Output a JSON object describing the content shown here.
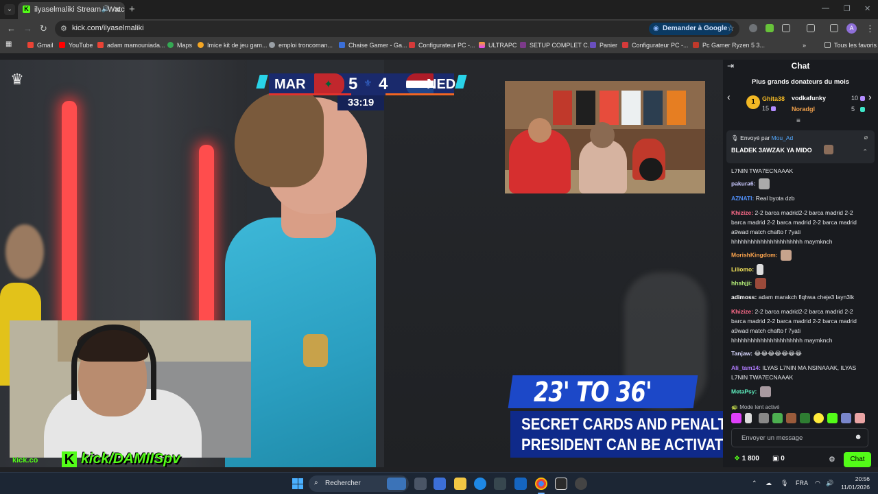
{
  "browser": {
    "tab_title": "ilyaselmaliki Stream - Watc",
    "url": "kick.com/ilyaselmaliki",
    "ask_google": "Demander à Google",
    "bookmarks": [
      "Gmail",
      "YouTube",
      "adam mamouniada...",
      "Maps",
      "Imice kit de jeu gam...",
      "emploi troncoman...",
      "Chaise Gamer - Ga...",
      "Configurateur PC -...",
      "ULTRAPC",
      "SETUP COMPLET C...",
      "Panier",
      "Configurateur PC -...",
      "Pc Gamer Ryzen 5 3..."
    ],
    "all_bookmarks": "Tous les favoris",
    "profile_initial": "A"
  },
  "scoreboard": {
    "home": "MAR",
    "away": "NED",
    "home_score": "5",
    "away_score": "4",
    "clock": "33:19"
  },
  "overlay": {
    "kick_handle": "kick/DAMIISpv",
    "promo_top": "23' TO 36'",
    "promo_line1": "SECRET CARDS AND PENALTY",
    "promo_line2": "PRESIDENT CAN BE ACTIVATED"
  },
  "chat": {
    "title": "Chat",
    "donors_title": "Plus grands donateurs du mois",
    "donors": [
      {
        "rank": "1",
        "name": "Ghita38",
        "amount": "15",
        "color": "#f2b824"
      },
      {
        "name": "vodkafunky",
        "amount": "10",
        "color": "#ffffff"
      },
      {
        "name": "Noradgl",
        "amount": "5",
        "color": "#f0a04b"
      }
    ],
    "pinned": {
      "sent_by_label": "Envoyé par",
      "sent_by_user": "Mou_Ad",
      "message": "BLADEK 3AWZAK YA MIDO"
    },
    "messages": [
      {
        "user": "",
        "color": "#ffffff",
        "text": "L7NIN TWA7ECNAAAK"
      },
      {
        "user": "pakura6:",
        "color": "#c9c9ff",
        "text": ""
      },
      {
        "user": "AZNATI:",
        "color": "#4f8ef7",
        "text": "Real byota dzb"
      },
      {
        "user": "Khizize:",
        "color": "#ff6b8a",
        "text": "2-2 barca madrid2-2 barca madrid 2-2 barca madrid 2-2 barca madrid 2-2 barca madrid a9wad match chafto f 7yati hhhhhhhhhhhhhhhhhhhhhh maymknch"
      },
      {
        "user": "MorishKingdom:",
        "color": "#ffa64d",
        "text": ""
      },
      {
        "user": "Liliomo:",
        "color": "#f2e35a",
        "text": ""
      },
      {
        "user": "hhshjji:",
        "color": "#b7f27a",
        "text": ""
      },
      {
        "user": "adimoss:",
        "color": "#ffffff",
        "text": "adam marakch flqhwa cheje3 layn3lk"
      },
      {
        "user": "Khizize:",
        "color": "#ff6b8a",
        "text": "2-2 barca madrid2-2 barca madrid 2-2 barca madrid 2-2 barca madrid 2-2 barca madrid a9wad match chafto f 7yati hhhhhhhhhhhhhhhhhhhhhh maymknch"
      },
      {
        "user": "Tanjaw:",
        "color": "#d8d8ff",
        "text": "😂😂😂😂😂😂😂"
      },
      {
        "user": "Ali_tam14:",
        "color": "#b07cff",
        "text": "ILYAS L7NIN MA NSINAAAK, ILYAS L7NIN TWA7ECNAAAK"
      },
      {
        "user": "MetaPsy:",
        "color": "#5ff0c0",
        "text": ""
      }
    ],
    "slow_mode": "Mode lent activé",
    "input_placeholder": "Envoyer un message",
    "points": "1 800",
    "drops": "0",
    "send_label": "Chat"
  },
  "taskbar": {
    "search_label": "Rechercher",
    "lang": "FRA",
    "time": "20:56",
    "date": "11/01/2026"
  }
}
